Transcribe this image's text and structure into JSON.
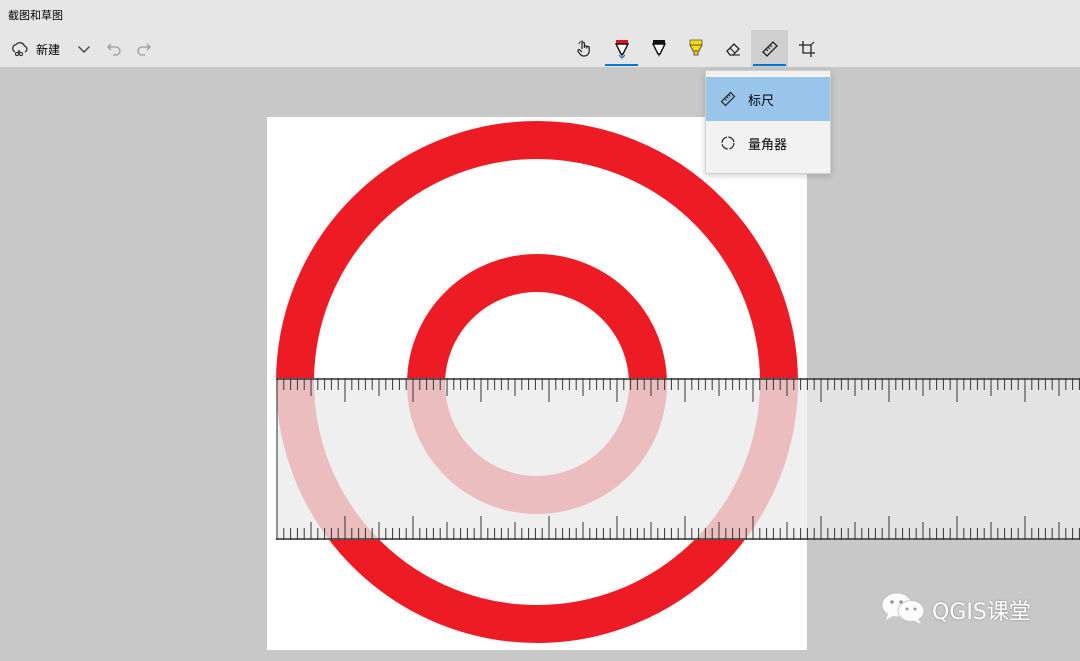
{
  "window": {
    "title": "截图和草图"
  },
  "toolbar": {
    "new_label": "新建",
    "new_icon": "new-snip-icon",
    "undo_icon": "undo-icon",
    "redo_icon": "redo-icon",
    "tools": [
      {
        "name": "touch-writing",
        "icon": "touch-hand-icon"
      },
      {
        "name": "ballpoint-pen",
        "icon": "ballpoint-pen-icon",
        "color": "#e81123",
        "active": true
      },
      {
        "name": "pencil",
        "icon": "pencil-icon",
        "color": "#000000"
      },
      {
        "name": "highlighter",
        "icon": "highlighter-icon",
        "color": "#ffd800"
      },
      {
        "name": "eraser",
        "icon": "eraser-icon"
      },
      {
        "name": "ruler",
        "icon": "ruler-icon",
        "selected": true
      },
      {
        "name": "crop",
        "icon": "crop-icon"
      }
    ]
  },
  "ruler_menu": {
    "items": [
      {
        "label": "标尺",
        "icon": "ruler-icon",
        "highlighted": true
      },
      {
        "label": "量角器",
        "icon": "protractor-icon",
        "highlighted": false
      }
    ]
  },
  "drawing": {
    "stroke_color": "#ed1c24",
    "shapes": [
      "outer-ring",
      "inner-ring"
    ]
  },
  "colors": {
    "toolbar_bg": "#e6e6e6",
    "workspace_bg": "#c8c8c8",
    "accent": "#0078d7",
    "menu_highlight": "#99c5ea"
  },
  "watermark": {
    "text": "QGIS课堂",
    "icon": "wechat-icon"
  }
}
